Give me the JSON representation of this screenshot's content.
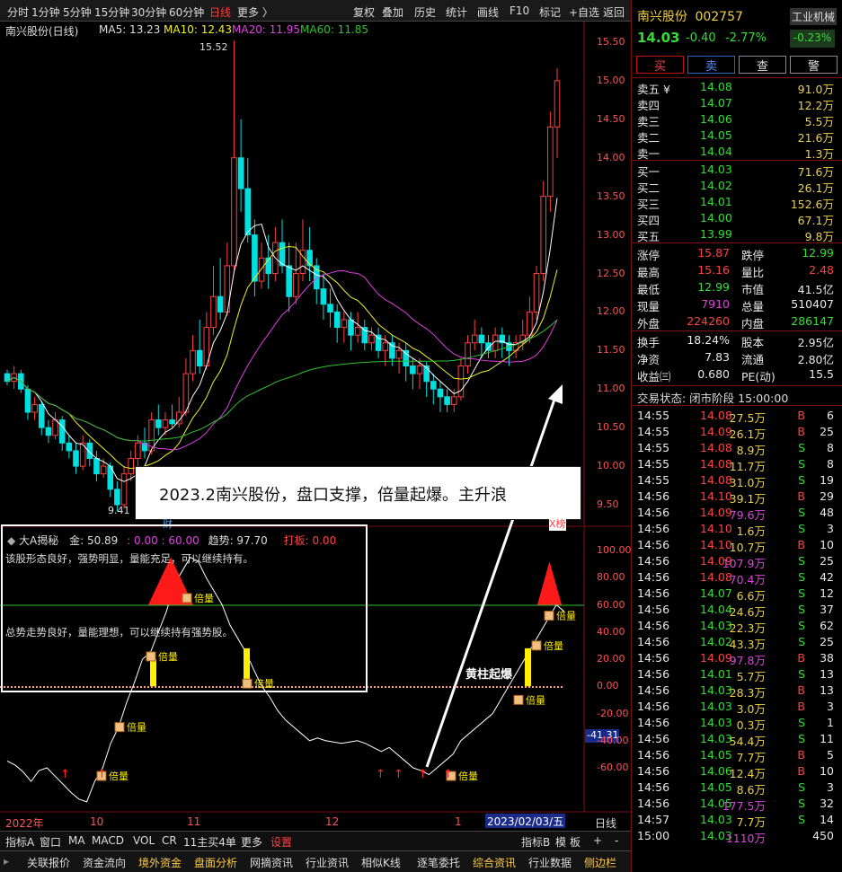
{
  "toolbar": {
    "periods": [
      "分时",
      "1分钟",
      "5分钟",
      "15分钟",
      "30分钟",
      "60分钟",
      "日线",
      "更多 〉"
    ],
    "actions": [
      "复权",
      "叠加",
      "历史",
      "统计",
      "画线",
      "F10",
      "标记",
      "+自选",
      "返回"
    ]
  },
  "chart": {
    "title": "南兴股份(日线)",
    "ma_labels": [
      "MA5: 13.23",
      "MA10: 12.43",
      "MA20: 11.95",
      "MA60: 11.85"
    ],
    "price_ticks": [
      "15.50",
      "15.00",
      "14.50",
      "14.00",
      "13.50",
      "13.00",
      "12.50",
      "12.00",
      "11.50",
      "11.00",
      "10.50",
      "10.00",
      "9.50"
    ],
    "high_label": "15.52",
    "low_label": "9.41",
    "annotation": "2023.2南兴股份，盘口支撑，倍量起爆。主升浪",
    "cai_label": "财",
    "bang_label": "X榜",
    "candles": [
      [
        11.2,
        11.1,
        11.25,
        11.05
      ],
      [
        11.1,
        11.2,
        11.3,
        11.0
      ],
      [
        11.2,
        11.0,
        11.25,
        10.95
      ],
      [
        11.0,
        10.7,
        11.05,
        10.6
      ],
      [
        10.7,
        10.8,
        10.9,
        10.6
      ],
      [
        10.8,
        10.5,
        10.85,
        10.4
      ],
      [
        10.5,
        10.4,
        10.6,
        10.3
      ],
      [
        10.4,
        10.6,
        10.7,
        10.35
      ],
      [
        10.6,
        10.3,
        10.65,
        10.2
      ],
      [
        10.3,
        10.2,
        10.4,
        10.1
      ],
      [
        10.2,
        10.0,
        10.3,
        9.9
      ],
      [
        10.0,
        10.3,
        10.4,
        9.95
      ],
      [
        10.3,
        10.1,
        10.35,
        10.0
      ],
      [
        10.1,
        9.9,
        10.2,
        9.8
      ],
      [
        9.9,
        10.0,
        10.1,
        9.85
      ],
      [
        10.0,
        9.7,
        10.05,
        9.6
      ],
      [
        9.7,
        9.5,
        9.8,
        9.41
      ],
      [
        9.5,
        9.9,
        10.0,
        9.45
      ],
      [
        9.9,
        10.1,
        10.2,
        9.8
      ],
      [
        10.1,
        10.3,
        10.4,
        10.0
      ],
      [
        10.3,
        10.2,
        10.5,
        10.1
      ],
      [
        10.2,
        10.6,
        10.7,
        10.15
      ],
      [
        10.6,
        10.5,
        10.8,
        10.4
      ],
      [
        10.5,
        10.6,
        10.7,
        10.4
      ],
      [
        10.6,
        10.55,
        10.8,
        10.5
      ],
      [
        10.55,
        10.7,
        10.9,
        10.5
      ],
      [
        10.7,
        11.2,
        11.4,
        10.65
      ],
      [
        11.2,
        11.5,
        11.7,
        11.1
      ],
      [
        11.5,
        11.3,
        11.9,
        11.2
      ],
      [
        11.3,
        11.8,
        12.0,
        11.25
      ],
      [
        11.8,
        12.2,
        12.6,
        11.7
      ],
      [
        12.2,
        12.0,
        12.7,
        11.9
      ],
      [
        12.0,
        12.6,
        12.9,
        11.95
      ],
      [
        12.6,
        14.0,
        15.52,
        12.5
      ],
      [
        14.0,
        13.6,
        14.5,
        13.3
      ],
      [
        13.6,
        13.0,
        14.0,
        12.9
      ],
      [
        13.0,
        12.4,
        13.2,
        12.2
      ],
      [
        12.4,
        12.7,
        12.9,
        12.3
      ],
      [
        12.7,
        12.5,
        13.0,
        12.3
      ],
      [
        12.5,
        12.9,
        13.1,
        12.4
      ],
      [
        12.9,
        12.6,
        13.2,
        12.5
      ],
      [
        12.6,
        12.2,
        12.9,
        12.0
      ],
      [
        12.2,
        12.5,
        12.9,
        12.1
      ],
      [
        12.5,
        12.8,
        13.2,
        12.4
      ],
      [
        12.8,
        12.6,
        13.1,
        12.4
      ],
      [
        12.6,
        12.3,
        12.7,
        12.1
      ],
      [
        12.3,
        12.1,
        12.5,
        11.9
      ],
      [
        12.1,
        12.0,
        12.3,
        11.8
      ],
      [
        12.0,
        11.8,
        12.1,
        11.6
      ],
      [
        11.8,
        11.9,
        12.0,
        11.6
      ],
      [
        11.9,
        11.7,
        12.0,
        11.5
      ],
      [
        11.7,
        11.8,
        12.0,
        11.6
      ],
      [
        11.8,
        11.6,
        11.9,
        11.5
      ],
      [
        11.6,
        11.7,
        11.8,
        11.5
      ],
      [
        11.7,
        11.5,
        11.8,
        11.4
      ],
      [
        11.5,
        11.6,
        11.7,
        11.3
      ],
      [
        11.6,
        11.4,
        11.7,
        11.3
      ],
      [
        11.4,
        11.5,
        11.6,
        11.2
      ],
      [
        11.5,
        11.3,
        11.6,
        11.1
      ],
      [
        11.3,
        11.2,
        11.4,
        11.0
      ],
      [
        11.2,
        11.3,
        11.4,
        11.0
      ],
      [
        11.3,
        11.1,
        11.35,
        10.9
      ],
      [
        11.1,
        11.0,
        11.2,
        10.8
      ],
      [
        11.0,
        10.9,
        11.1,
        10.7
      ],
      [
        10.9,
        10.8,
        11.0,
        10.7
      ],
      [
        10.8,
        10.9,
        11.0,
        10.7
      ],
      [
        10.9,
        11.3,
        11.4,
        10.85
      ],
      [
        11.3,
        11.6,
        11.7,
        11.2
      ],
      [
        11.6,
        11.7,
        11.9,
        11.5
      ],
      [
        11.7,
        11.6,
        11.8,
        11.4
      ],
      [
        11.6,
        11.5,
        11.7,
        11.4
      ],
      [
        11.5,
        11.7,
        11.8,
        11.4
      ],
      [
        11.7,
        11.6,
        11.8,
        11.4
      ],
      [
        11.6,
        11.5,
        11.7,
        11.3
      ],
      [
        11.5,
        11.6,
        11.7,
        11.4
      ],
      [
        11.6,
        11.7,
        11.9,
        11.5
      ],
      [
        11.7,
        12.0,
        12.2,
        11.6
      ],
      [
        12.0,
        12.5,
        12.6,
        11.9
      ],
      [
        12.5,
        13.5,
        13.7,
        12.4
      ],
      [
        13.5,
        14.4,
        14.6,
        13.3
      ],
      [
        14.4,
        15.0,
        15.16,
        14.0
      ]
    ],
    "sub": {
      "title": "大A揭秘",
      "jin": "金: 50.89",
      "ratio": ": 0.00 : 60.00",
      "trend": "趋势: 97.70",
      "daban": "打板: 0.00",
      "line1": "该股形态良好，强势明显，量能充足，可以继续持有。",
      "line2": "总势走势良好，量能理想，可以继续持有强势股。",
      "yellow_label": "黄柱起爆",
      "beiliang": "倍量",
      "current": "-41.31",
      "ticks": [
        "100.00",
        "80.00",
        "60.00",
        "40.00",
        "20.00",
        "0.00",
        "-20.00",
        "-40.00",
        "-60.00"
      ],
      "line": [
        -55,
        -58,
        -63,
        -70,
        -62,
        -60,
        -66,
        -72,
        -78,
        -83,
        -85,
        -70,
        -60,
        -42,
        -30,
        -12,
        3,
        20,
        25,
        40,
        55,
        75,
        85,
        95,
        92,
        80,
        70,
        60,
        45,
        35,
        25,
        12,
        0,
        -8,
        -18,
        -25,
        -30,
        -35,
        -40,
        -38,
        -40,
        -41,
        -42,
        -41,
        -40,
        -42,
        -45,
        -48,
        -45,
        -50,
        -55,
        -60,
        -62,
        -65,
        -60,
        -55,
        -50,
        -40,
        -35,
        -30,
        -25,
        -20,
        -10,
        0,
        10,
        20,
        30,
        40,
        50,
        60,
        55
      ]
    },
    "date_labels": [
      "2022年",
      "10",
      "11",
      "12",
      "1",
      "2023/02/03/五"
    ],
    "period_label": "日线"
  },
  "indicator_tabs": [
    "指标A",
    "窗口",
    "MA",
    "MACD",
    "VOL",
    "CR",
    "11主买4单",
    "更多",
    "设置"
  ],
  "indicator_right": [
    "指标B",
    "模",
    "板",
    "+",
    "-"
  ],
  "bottom_tabs": [
    "关联报价",
    "资金流向",
    "境外资金",
    "盘面分析",
    "网摘资讯",
    "行业资讯",
    "相似K线",
    "逐笔委托",
    "综合资讯",
    "行业数据",
    "侧边栏"
  ],
  "right_tabs": [
    "笔",
    "价",
    "细",
    "势",
    "联",
    "值",
    "主",
    "筹"
  ],
  "quote": {
    "name": "南兴股份",
    "code": "002757",
    "industry": "工业机械",
    "industry_pct": "-0.23%",
    "price": "14.03",
    "change": "-0.40",
    "change_pct": "-2.77%",
    "buttons": [
      "买",
      "卖",
      "查",
      "警"
    ],
    "sells": [
      [
        "卖五 ¥",
        "14.08",
        "91.0万"
      ],
      [
        "卖四",
        "14.07",
        "12.2万"
      ],
      [
        "卖三",
        "14.06",
        "5.5万"
      ],
      [
        "卖二",
        "14.05",
        "21.6万"
      ],
      [
        "卖一",
        "14.04",
        "1.3万"
      ]
    ],
    "buys": [
      [
        "买一",
        "14.03",
        "71.6万"
      ],
      [
        "买二",
        "14.02",
        "26.1万"
      ],
      [
        "买三",
        "14.01",
        "152.6万"
      ],
      [
        "买四",
        "14.00",
        "67.1万"
      ],
      [
        "买五",
        "13.99",
        "9.8万"
      ]
    ],
    "stats": [
      [
        "涨停",
        "15.87",
        "跌停",
        "12.99"
      ],
      [
        "最高",
        "15.16",
        "量比",
        "2.48"
      ],
      [
        "最低",
        "12.99",
        "市值",
        "41.5亿"
      ],
      [
        "现量",
        "7910",
        "总量",
        "510407"
      ],
      [
        "外盘",
        "224260",
        "内盘",
        "286147"
      ]
    ],
    "stats2": [
      [
        "换手",
        "18.24%",
        "股本",
        "2.95亿"
      ],
      [
        "净资",
        "7.83",
        "流通",
        "2.80亿"
      ],
      [
        "收益㈢",
        "0.680",
        "PE(动)",
        "15.5"
      ]
    ],
    "status": "交易状态: 闭市阶段 15:00:00",
    "ticks": [
      [
        "14:55",
        "14.08",
        "27.5万",
        "B",
        "6"
      ],
      [
        "14:55",
        "14.09",
        "26.1万",
        "B",
        "25"
      ],
      [
        "14:55",
        "14.08",
        "8.9万",
        "S",
        "8"
      ],
      [
        "14:55",
        "14.08",
        "11.7万",
        "S",
        "8"
      ],
      [
        "14:55",
        "14.08",
        "31.0万",
        "S",
        "19"
      ],
      [
        "14:56",
        "14.10",
        "39.1万",
        "B",
        "29"
      ],
      [
        "14:56",
        "14.09",
        "79.6万",
        "S",
        "48"
      ],
      [
        "14:56",
        "14.10",
        "1.6万",
        "S",
        "3"
      ],
      [
        "14:56",
        "14.10",
        "10.7万",
        "B",
        "10"
      ],
      [
        "14:56",
        "14.09",
        "107.9万",
        "S",
        "25"
      ],
      [
        "14:56",
        "14.08",
        "70.4万",
        "S",
        "42"
      ],
      [
        "14:56",
        "14.07",
        "6.6万",
        "S",
        "12"
      ],
      [
        "14:56",
        "14.04",
        "24.6万",
        "S",
        "37"
      ],
      [
        "14:56",
        "14.03",
        "22.3万",
        "S",
        "62"
      ],
      [
        "14:56",
        "14.02",
        "43.3万",
        "S",
        "25"
      ],
      [
        "14:56",
        "14.09",
        "97.8万",
        "B",
        "38"
      ],
      [
        "14:56",
        "14.01",
        "5.7万",
        "S",
        "13"
      ],
      [
        "14:56",
        "14.03",
        "28.3万",
        "B",
        "13"
      ],
      [
        "14:56",
        "14.03",
        "3.0万",
        "B",
        "3"
      ],
      [
        "14:56",
        "14.03",
        "0.3万",
        "S",
        "1"
      ],
      [
        "14:56",
        "14.03",
        "54.4万",
        "S",
        "11"
      ],
      [
        "14:56",
        "14.05",
        "7.7万",
        "B",
        "5"
      ],
      [
        "14:56",
        "14.06",
        "12.4万",
        "B",
        "10"
      ],
      [
        "14:56",
        "14.05",
        "8.6万",
        "S",
        "3"
      ],
      [
        "14:56",
        "14.05",
        "177.5万",
        "S",
        "32"
      ],
      [
        "14:57",
        "14.03",
        "7.7万",
        "S",
        "14"
      ],
      [
        "15:00",
        "14.03",
        "1110万",
        "",
        "450"
      ]
    ]
  },
  "colors": {
    "up": "#ff4040",
    "down": "#00e0e0",
    "ma5": "#ffffff",
    "ma10": "#f0f020",
    "ma20": "#e040e0",
    "ma60": "#30c030"
  }
}
